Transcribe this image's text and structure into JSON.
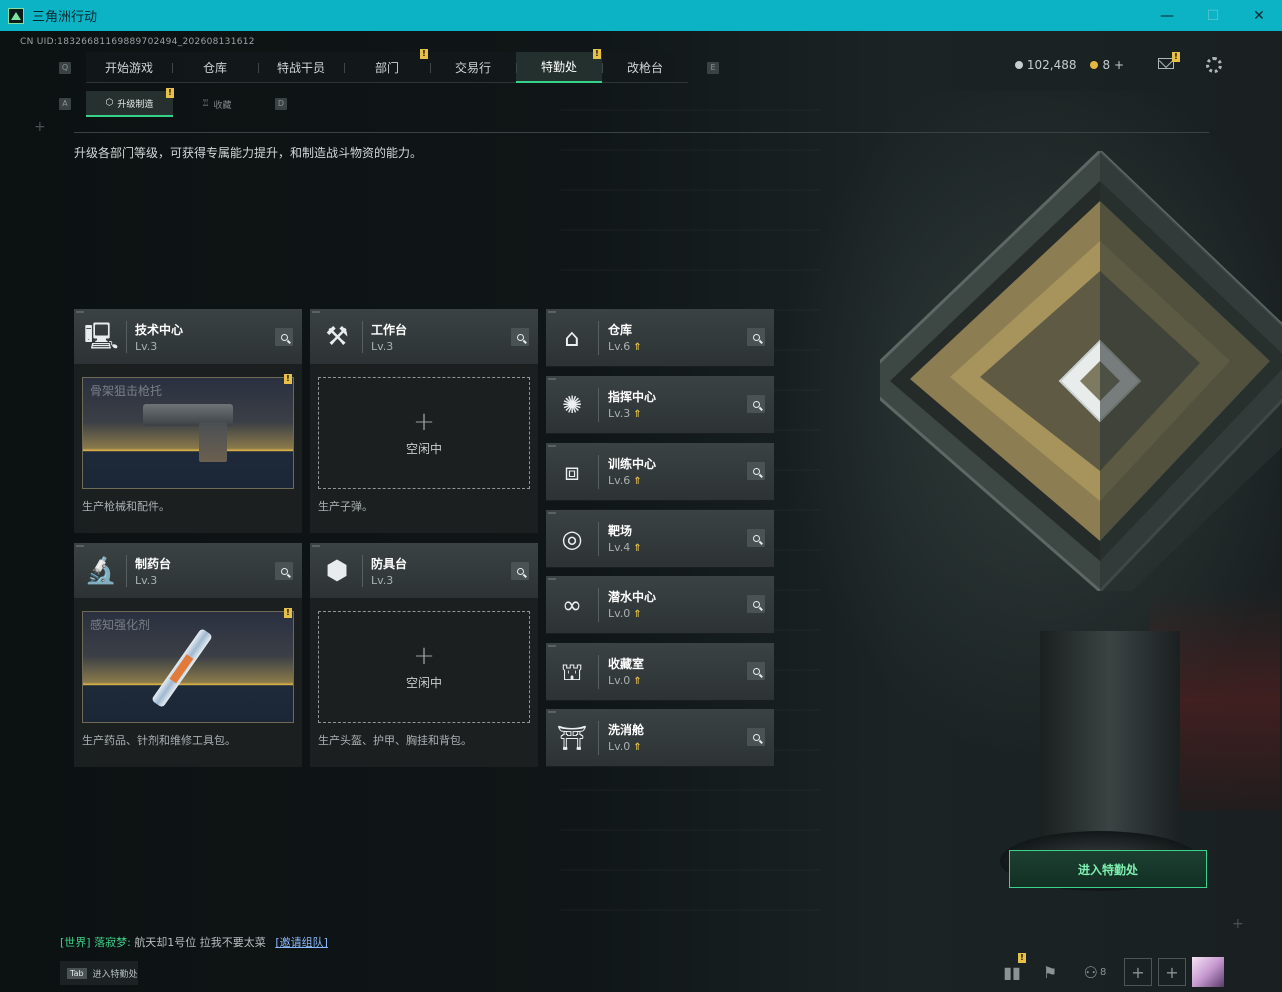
{
  "window": {
    "title": "三角洲行动",
    "minimize": "—",
    "maximize": "☐",
    "close": "✕"
  },
  "uid": "CN UID:18326681169889702494_202608131612",
  "nav": {
    "left_key": "Q",
    "right_key": "E",
    "items": [
      {
        "label": "开始游戏",
        "badge": ""
      },
      {
        "label": "仓库",
        "badge": ""
      },
      {
        "label": "特战干员",
        "badge": ""
      },
      {
        "label": "部门",
        "badge": "!"
      },
      {
        "label": "交易行",
        "badge": ""
      },
      {
        "label": "特勤处",
        "badge": "!"
      },
      {
        "label": "改枪台",
        "badge": ""
      }
    ],
    "active": "特勤处"
  },
  "currency": {
    "silver": "102,488",
    "gold": "8",
    "gold_add": "+"
  },
  "subnav": {
    "left_key": "A",
    "right_key": "D",
    "items": [
      {
        "label": "升级制造",
        "badge": "!",
        "icon": "hexagon-icon"
      },
      {
        "label": "收藏",
        "badge": "",
        "icon": "trophy-icon"
      }
    ]
  },
  "description": "升级各部门等级，可获得专属能力提升，和制造战斗物资的能力。",
  "production": [
    {
      "name": "技术中心",
      "level": "Lv.3",
      "icon": "monitor-icon",
      "status": "item",
      "item_name": "骨架狙击枪托",
      "badge": "!",
      "footer": "生产枪械和配件。"
    },
    {
      "name": "工作台",
      "level": "Lv.3",
      "icon": "tools-icon",
      "status": "idle",
      "idle_label": "空闲中",
      "footer": "生产子弹。"
    },
    {
      "name": "制药台",
      "level": "Lv.3",
      "icon": "microscope-icon",
      "status": "item",
      "item_name": "感知强化剂",
      "badge": "!",
      "footer": "生产药品、针剂和维修工具包。"
    },
    {
      "name": "防具台",
      "level": "Lv.3",
      "icon": "cubes-icon",
      "status": "idle",
      "idle_label": "空闲中",
      "footer": "生产头盔、护甲、胸挂和背包。"
    }
  ],
  "facilities": [
    {
      "name": "仓库",
      "level": "Lv.6",
      "icon": "garage-icon",
      "upgradable": "⇑"
    },
    {
      "name": "指挥中心",
      "level": "Lv.3",
      "icon": "command-icon",
      "upgradable": "⇑"
    },
    {
      "name": "训练中心",
      "level": "Lv.6",
      "icon": "dumbbell-icon",
      "upgradable": "⇑"
    },
    {
      "name": "靶场",
      "level": "Lv.4",
      "icon": "target-icon",
      "upgradable": "⇑"
    },
    {
      "name": "潜水中心",
      "level": "Lv.0",
      "icon": "diving-mask-icon",
      "upgradable": "⇑"
    },
    {
      "name": "收藏室",
      "level": "Lv.0",
      "icon": "collection-icon",
      "upgradable": "⇑"
    },
    {
      "name": "洗消舱",
      "level": "Lv.0",
      "icon": "decon-icon",
      "upgradable": "⇑"
    }
  ],
  "enter_button": "进入特勤处",
  "chat": {
    "channel": "[世界]",
    "sender": "落寂梦:",
    "message": "航天却1号位 拉我不要太菜",
    "action": "[邀请组队]"
  },
  "tab_hint": {
    "key": "Tab",
    "label": "进入特勤处"
  },
  "bottom_bar": {
    "friend_count": "8",
    "stats_badge": "!"
  },
  "colors": {
    "accent": "#36d28a",
    "titlebar": "#0cb3c5",
    "badge": "#e7c04a",
    "upgrade_arrow": "#e6c04c"
  }
}
